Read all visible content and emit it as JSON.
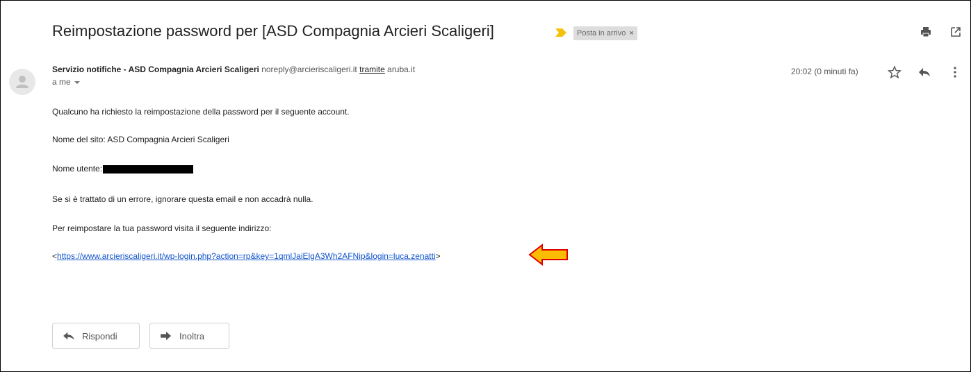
{
  "header": {
    "subject": "Reimpostazione password per [ASD Compagnia Arcieri Scaligeri]",
    "label": "Posta in arrivo",
    "label_remove": "×",
    "label_color": "#f4c20d",
    "icons": [
      "print-icon",
      "open-in-new-window-icon"
    ]
  },
  "message": {
    "sender_name": "Servizio notifiche - ASD Compagnia Arcieri Scaligeri",
    "sender_email": "noreply@arcieriscaligeri.it",
    "via_text": "tramite",
    "via_domain": "aruba.it",
    "recipient": "a me",
    "time": "20:02 (0 minuti fa)",
    "actions": [
      "star-icon",
      "reply-icon",
      "more-options-icon"
    ]
  },
  "body": {
    "line1": "Qualcuno ha richiesto la reimpostazione della password per il seguente account.",
    "line2": "Nome del sito: ASD Compagnia Arcieri Scaligeri",
    "line3_label": "Nome utente:",
    "line4": "Se si è trattato di un errore, ignorare questa email e non accadrà nulla.",
    "line5": "Per reimpostare la tua password visita il seguente indirizzo:",
    "link_open": "<",
    "link_url": "https://www.arcieriscaligeri.it/wp-login.php?action=rp&key=1qmlJaiElgA3Wh2AFNip&login=luca.zenatti",
    "link_close": ">",
    "callout_color": "#fbbc04",
    "callout_border": "#e00000"
  },
  "footer": {
    "reply_label": "Rispondi",
    "forward_label": "Inoltra"
  }
}
